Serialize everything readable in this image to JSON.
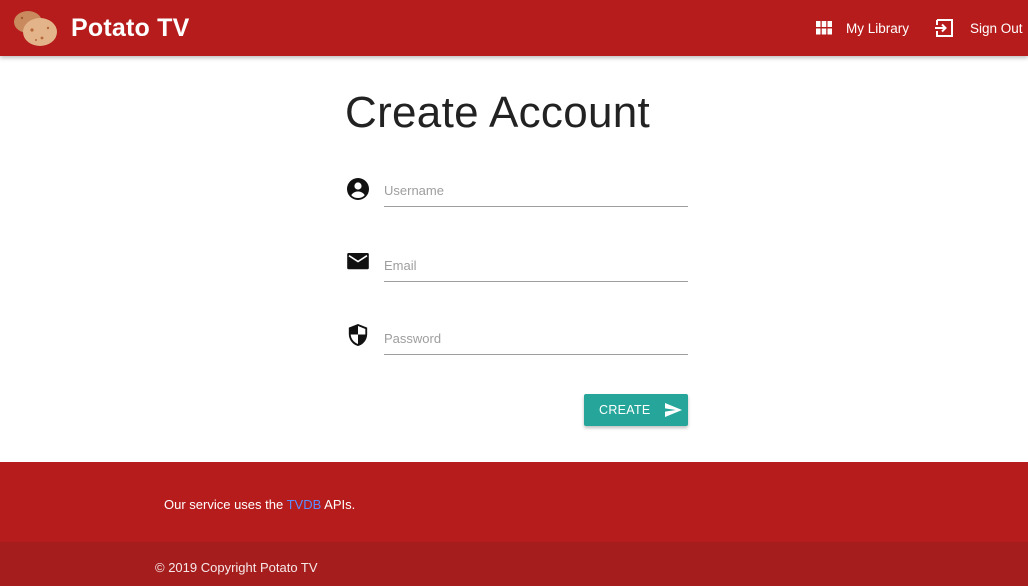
{
  "app": {
    "name": "Potato TV",
    "accent": "#b71c1c",
    "button_color": "#26a69a"
  },
  "nav": {
    "library_label": "My Library",
    "library_icon": "grid-icon",
    "signout_label": "Sign Out",
    "signout_icon": "exit-icon"
  },
  "form": {
    "title": "Create Account",
    "username": {
      "placeholder": "Username",
      "value": "",
      "icon": "account-circle-icon"
    },
    "email": {
      "placeholder": "Email",
      "value": "",
      "icon": "mail-icon"
    },
    "password": {
      "placeholder": "Password",
      "value": "",
      "icon": "security-shield-icon"
    },
    "submit_label": "CREATE",
    "submit_icon": "send-icon"
  },
  "footer": {
    "text_before": "Our service uses the ",
    "link_text": "TVDB",
    "text_after": " APIs.",
    "copyright": "© 2019 Copyright Potato TV"
  }
}
